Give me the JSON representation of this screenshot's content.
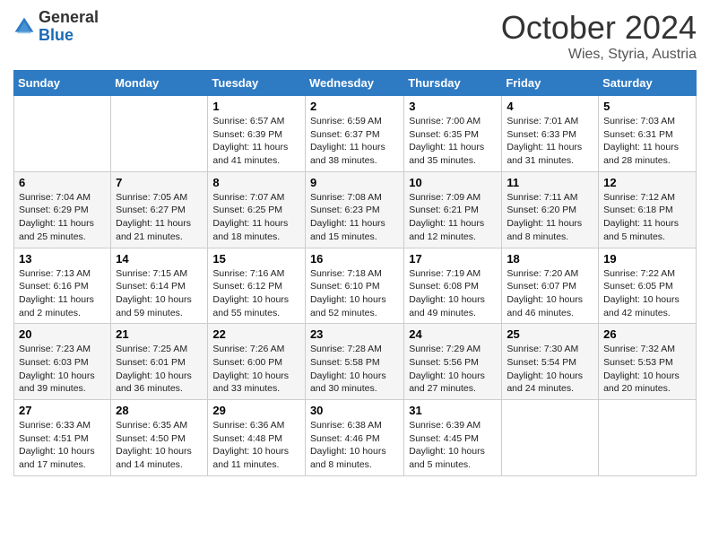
{
  "header": {
    "logo_general": "General",
    "logo_blue": "Blue",
    "month_title": "October 2024",
    "location": "Wies, Styria, Austria"
  },
  "days_of_week": [
    "Sunday",
    "Monday",
    "Tuesday",
    "Wednesday",
    "Thursday",
    "Friday",
    "Saturday"
  ],
  "weeks": [
    [
      {
        "day": "",
        "info": ""
      },
      {
        "day": "",
        "info": ""
      },
      {
        "day": "1",
        "sunrise": "6:57 AM",
        "sunset": "6:39 PM",
        "daylight": "11 hours and 41 minutes."
      },
      {
        "day": "2",
        "sunrise": "6:59 AM",
        "sunset": "6:37 PM",
        "daylight": "11 hours and 38 minutes."
      },
      {
        "day": "3",
        "sunrise": "7:00 AM",
        "sunset": "6:35 PM",
        "daylight": "11 hours and 35 minutes."
      },
      {
        "day": "4",
        "sunrise": "7:01 AM",
        "sunset": "6:33 PM",
        "daylight": "11 hours and 31 minutes."
      },
      {
        "day": "5",
        "sunrise": "7:03 AM",
        "sunset": "6:31 PM",
        "daylight": "11 hours and 28 minutes."
      }
    ],
    [
      {
        "day": "6",
        "sunrise": "7:04 AM",
        "sunset": "6:29 PM",
        "daylight": "11 hours and 25 minutes."
      },
      {
        "day": "7",
        "sunrise": "7:05 AM",
        "sunset": "6:27 PM",
        "daylight": "11 hours and 21 minutes."
      },
      {
        "day": "8",
        "sunrise": "7:07 AM",
        "sunset": "6:25 PM",
        "daylight": "11 hours and 18 minutes."
      },
      {
        "day": "9",
        "sunrise": "7:08 AM",
        "sunset": "6:23 PM",
        "daylight": "11 hours and 15 minutes."
      },
      {
        "day": "10",
        "sunrise": "7:09 AM",
        "sunset": "6:21 PM",
        "daylight": "11 hours and 12 minutes."
      },
      {
        "day": "11",
        "sunrise": "7:11 AM",
        "sunset": "6:20 PM",
        "daylight": "11 hours and 8 minutes."
      },
      {
        "day": "12",
        "sunrise": "7:12 AM",
        "sunset": "6:18 PM",
        "daylight": "11 hours and 5 minutes."
      }
    ],
    [
      {
        "day": "13",
        "sunrise": "7:13 AM",
        "sunset": "6:16 PM",
        "daylight": "11 hours and 2 minutes."
      },
      {
        "day": "14",
        "sunrise": "7:15 AM",
        "sunset": "6:14 PM",
        "daylight": "10 hours and 59 minutes."
      },
      {
        "day": "15",
        "sunrise": "7:16 AM",
        "sunset": "6:12 PM",
        "daylight": "10 hours and 55 minutes."
      },
      {
        "day": "16",
        "sunrise": "7:18 AM",
        "sunset": "6:10 PM",
        "daylight": "10 hours and 52 minutes."
      },
      {
        "day": "17",
        "sunrise": "7:19 AM",
        "sunset": "6:08 PM",
        "daylight": "10 hours and 49 minutes."
      },
      {
        "day": "18",
        "sunrise": "7:20 AM",
        "sunset": "6:07 PM",
        "daylight": "10 hours and 46 minutes."
      },
      {
        "day": "19",
        "sunrise": "7:22 AM",
        "sunset": "6:05 PM",
        "daylight": "10 hours and 42 minutes."
      }
    ],
    [
      {
        "day": "20",
        "sunrise": "7:23 AM",
        "sunset": "6:03 PM",
        "daylight": "10 hours and 39 minutes."
      },
      {
        "day": "21",
        "sunrise": "7:25 AM",
        "sunset": "6:01 PM",
        "daylight": "10 hours and 36 minutes."
      },
      {
        "day": "22",
        "sunrise": "7:26 AM",
        "sunset": "6:00 PM",
        "daylight": "10 hours and 33 minutes."
      },
      {
        "day": "23",
        "sunrise": "7:28 AM",
        "sunset": "5:58 PM",
        "daylight": "10 hours and 30 minutes."
      },
      {
        "day": "24",
        "sunrise": "7:29 AM",
        "sunset": "5:56 PM",
        "daylight": "10 hours and 27 minutes."
      },
      {
        "day": "25",
        "sunrise": "7:30 AM",
        "sunset": "5:54 PM",
        "daylight": "10 hours and 24 minutes."
      },
      {
        "day": "26",
        "sunrise": "7:32 AM",
        "sunset": "5:53 PM",
        "daylight": "10 hours and 20 minutes."
      }
    ],
    [
      {
        "day": "27",
        "sunrise": "6:33 AM",
        "sunset": "4:51 PM",
        "daylight": "10 hours and 17 minutes."
      },
      {
        "day": "28",
        "sunrise": "6:35 AM",
        "sunset": "4:50 PM",
        "daylight": "10 hours and 14 minutes."
      },
      {
        "day": "29",
        "sunrise": "6:36 AM",
        "sunset": "4:48 PM",
        "daylight": "10 hours and 11 minutes."
      },
      {
        "day": "30",
        "sunrise": "6:38 AM",
        "sunset": "4:46 PM",
        "daylight": "10 hours and 8 minutes."
      },
      {
        "day": "31",
        "sunrise": "6:39 AM",
        "sunset": "4:45 PM",
        "daylight": "10 hours and 5 minutes."
      },
      {
        "day": "",
        "info": ""
      },
      {
        "day": "",
        "info": ""
      }
    ]
  ],
  "labels": {
    "sunrise": "Sunrise:",
    "sunset": "Sunset:",
    "daylight": "Daylight:"
  }
}
